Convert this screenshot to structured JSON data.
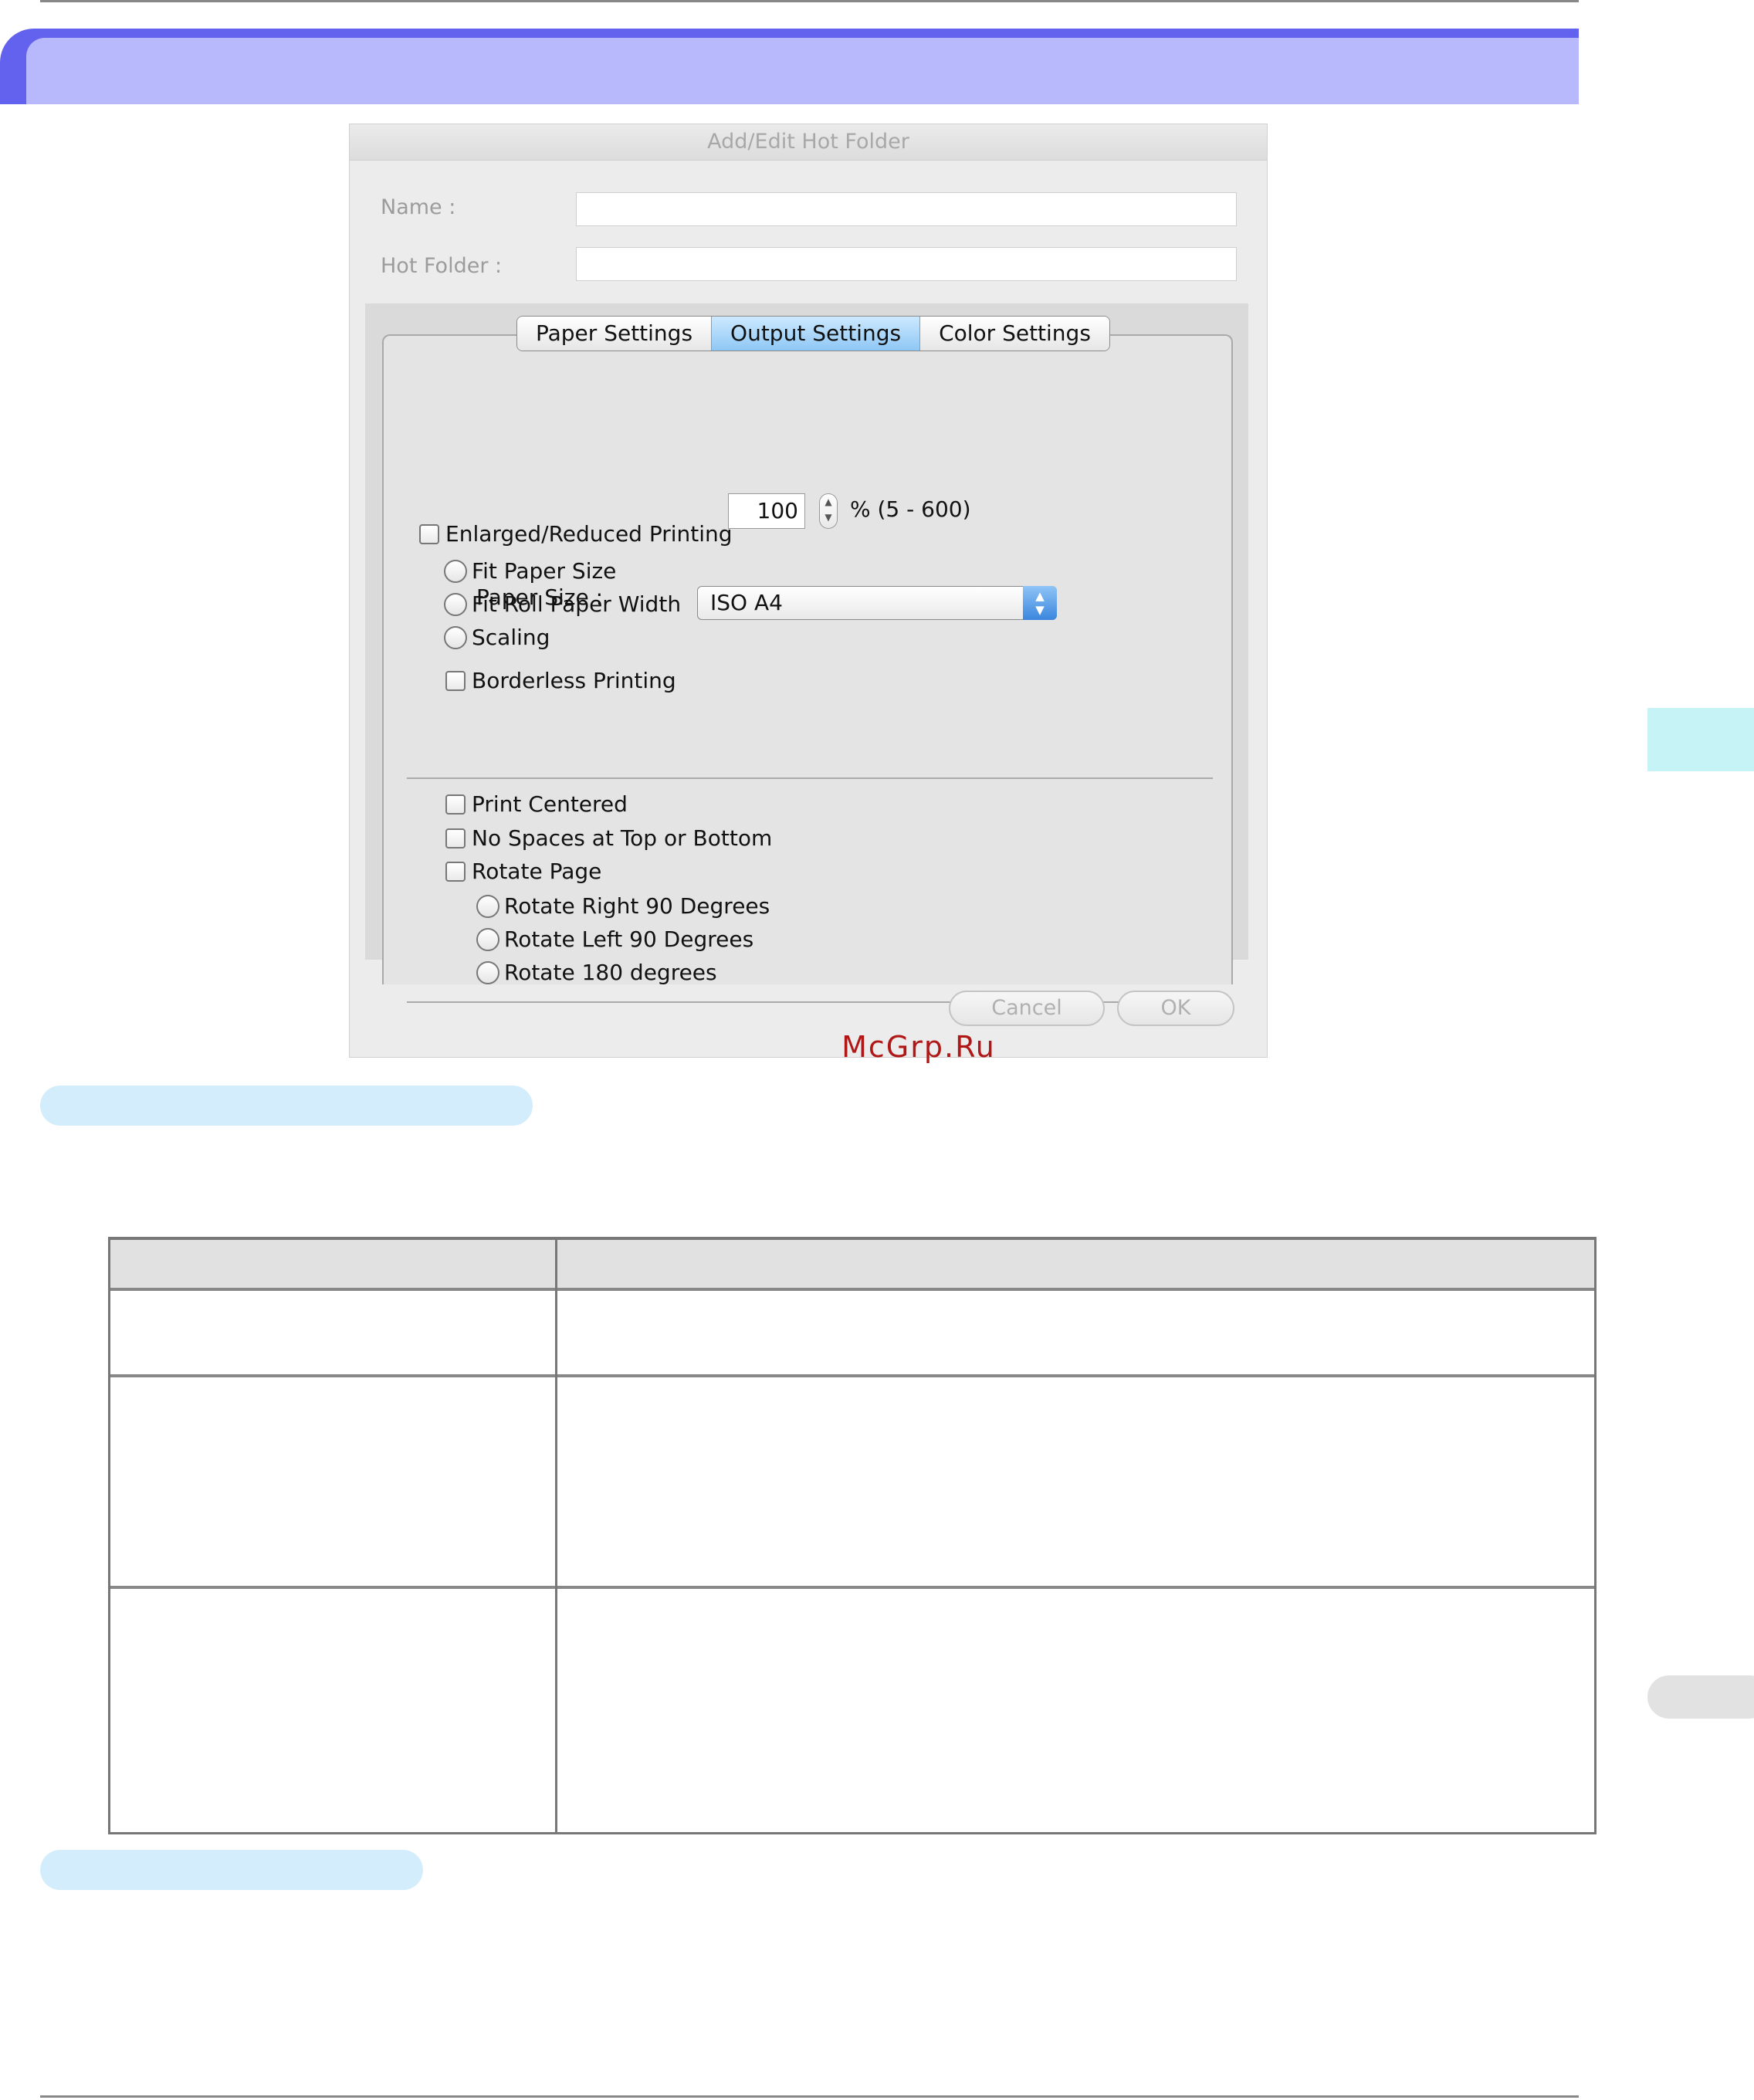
{
  "dialog": {
    "title": "Add/Edit Hot Folder",
    "name_label": "Name :",
    "name_value": "",
    "hot_folder_label": "Hot Folder :",
    "hot_folder_value": "",
    "tabs": [
      {
        "label": "Paper Settings",
        "active": false
      },
      {
        "label": "Output Settings",
        "active": true
      },
      {
        "label": "Color Settings",
        "active": false
      }
    ],
    "enlarged_reduced": {
      "label": "Enlarged/Reduced Printing",
      "checked": false
    },
    "fit_paper_size": {
      "label": "Fit Paper Size",
      "selected": false
    },
    "fit_roll_width": {
      "label": "Fit Roll Paper Width",
      "selected": false
    },
    "scaling": {
      "label": "Scaling",
      "selected": false,
      "value": "100",
      "range": "% (5 - 600)"
    },
    "borderless": {
      "label": "Borderless Printing",
      "checked": false
    },
    "paper_size": {
      "label": "Paper Size :",
      "value": "ISO A4"
    },
    "print_centered": {
      "label": "Print Centered",
      "checked": false
    },
    "no_spaces": {
      "label": "No Spaces at Top or Bottom",
      "checked": false
    },
    "rotate_page": {
      "label": "Rotate Page",
      "checked": false
    },
    "rotate_right": {
      "label": "Rotate Right 90 Degrees",
      "selected": false
    },
    "rotate_left": {
      "label": "Rotate Left 90 Degrees",
      "selected": false
    },
    "rotate_180": {
      "label": "Rotate 180 degrees",
      "selected": false
    },
    "cancel_label": "Cancel",
    "ok_label": "OK"
  },
  "watermark": "McGrp.Ru",
  "colors": {
    "header_dark": "#6262ee",
    "header_light": "#b8b8fc",
    "section_pill": "#d3edfc",
    "side_tab": "#c6f3f6",
    "active_tab": "#8ec7f5",
    "watermark": "#b01818"
  }
}
